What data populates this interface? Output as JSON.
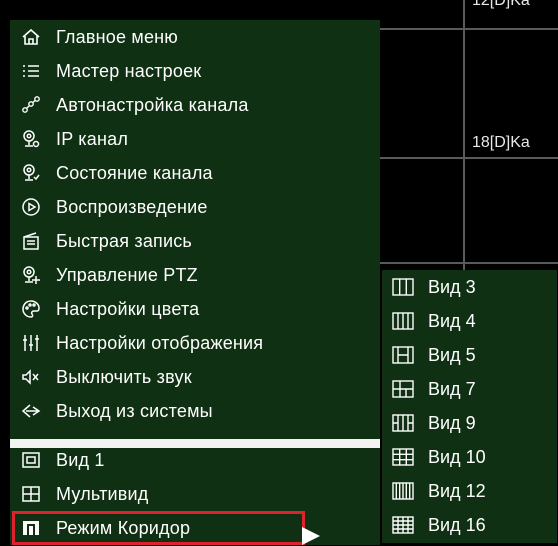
{
  "camera_labels": [
    "12[D]Ka",
    "18[D]Ka"
  ],
  "main_menu": {
    "items": [
      {
        "label": "Главное меню",
        "icon": "home-icon"
      },
      {
        "label": "Мастер настроек",
        "icon": "list-icon"
      },
      {
        "label": "Автонастройка канала",
        "icon": "network-icon"
      },
      {
        "label": "IP канал",
        "icon": "ip-camera-icon"
      },
      {
        "label": "Состояние канала",
        "icon": "camera-status-icon"
      },
      {
        "label": "Воспроизведение",
        "icon": "play-icon"
      },
      {
        "label": "Быстрая запись",
        "icon": "record-icon"
      },
      {
        "label": "Управление PTZ",
        "icon": "ptz-icon"
      },
      {
        "label": "Настройки цвета",
        "icon": "palette-icon"
      },
      {
        "label": "Настройки отображения",
        "icon": "sliders-icon"
      },
      {
        "label": "Выключить звук",
        "icon": "mute-icon"
      },
      {
        "label": "Выход из системы",
        "icon": "logout-icon"
      }
    ],
    "view_items": [
      {
        "label": "Вид 1",
        "icon": "single-view-icon"
      },
      {
        "label": "Мультивид",
        "icon": "multiview-icon"
      },
      {
        "label": "Режим Коридор",
        "icon": "corridor-mode-icon"
      }
    ]
  },
  "sub_menu": {
    "items": [
      {
        "label": "Вид 3",
        "icon": "view-3-icon"
      },
      {
        "label": "Вид 4",
        "icon": "view-4-icon"
      },
      {
        "label": "Вид 5",
        "icon": "view-5-icon"
      },
      {
        "label": "Вид 7",
        "icon": "view-7-icon"
      },
      {
        "label": "Вид 9",
        "icon": "view-9-icon"
      },
      {
        "label": "Вид 10",
        "icon": "view-10-icon"
      },
      {
        "label": "Вид 12",
        "icon": "view-12-icon"
      },
      {
        "label": "Вид 16",
        "icon": "view-16-icon"
      }
    ]
  },
  "colors": {
    "menu_bg": "#0f3012",
    "highlight": "#e0212e",
    "divider": "#f3f3f3"
  }
}
